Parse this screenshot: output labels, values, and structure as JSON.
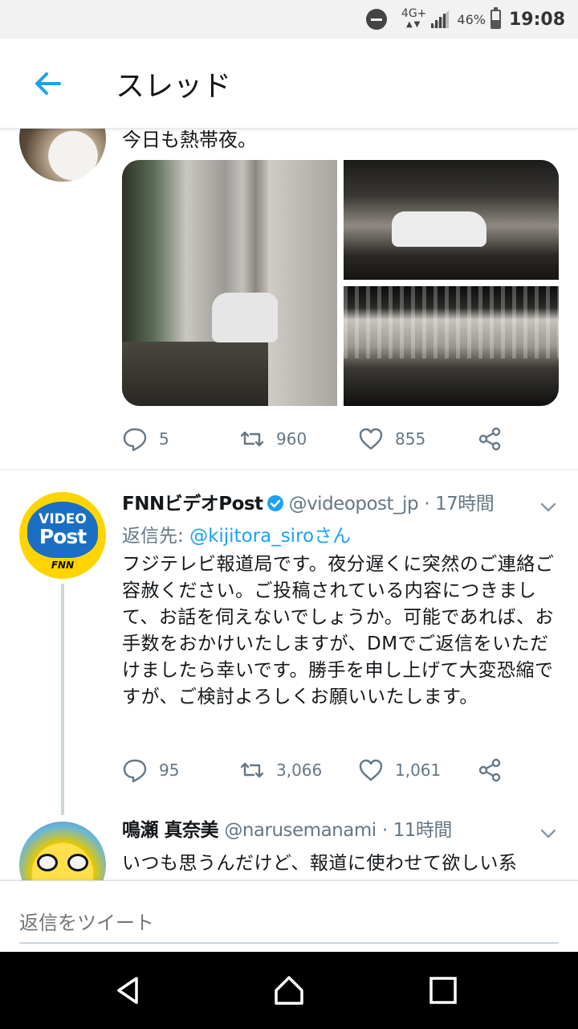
{
  "status_bar": {
    "network": "4G+",
    "network_arrows": "▲▼",
    "battery": "46%",
    "time": "19:08"
  },
  "header": {
    "title": "スレッド"
  },
  "tweet1": {
    "text": "今日も熱帯夜。",
    "reply_count": "5",
    "retweet_count": "960",
    "like_count": "855"
  },
  "tweet2": {
    "name": "FNNビデオPost",
    "handle": "@videopost_jp",
    "time": "· 17時間",
    "replying_label": "返信先: ",
    "replying_user": "@kijitora_siroさん",
    "body": "フジテレビ報道局です。夜分遅くに突然のご連絡ご容赦ください。ご投稿されている内容につきまして、お話を伺えないでしょうか。可能であれば、お手数をおかけいたしますが、DMでご返信をいただけましたら幸いです。勝手を申し上げて大変恐縮ですが、ご検討よろしくお願いいたします。",
    "reply_count": "95",
    "retweet_count": "3,066",
    "like_count": "1,061",
    "avatar_text": {
      "line1": "VIDEO",
      "line2": "Post",
      "line3": "FNN"
    }
  },
  "tweet3": {
    "name": "鳴瀬 真奈美",
    "handle": "@narusemanami",
    "time": "· 11時間",
    "body": "いつも思うんだけど、報道に使わせて欲しい系"
  },
  "reply_bar": {
    "placeholder": "返信をツイート"
  },
  "icons": {
    "back": "arrow-left-icon",
    "reply": "speech-bubble-icon",
    "retweet": "retweet-icon",
    "like": "heart-icon",
    "share": "share-icon",
    "verified": "verified-badge-icon",
    "caret": "chevron-down-icon"
  },
  "colors": {
    "accent": "#1da1f2",
    "secondary_text": "#657786",
    "primary_text": "#14171a",
    "fnn_yellow": "#ffd400",
    "fnn_blue": "#1a6fc4"
  }
}
